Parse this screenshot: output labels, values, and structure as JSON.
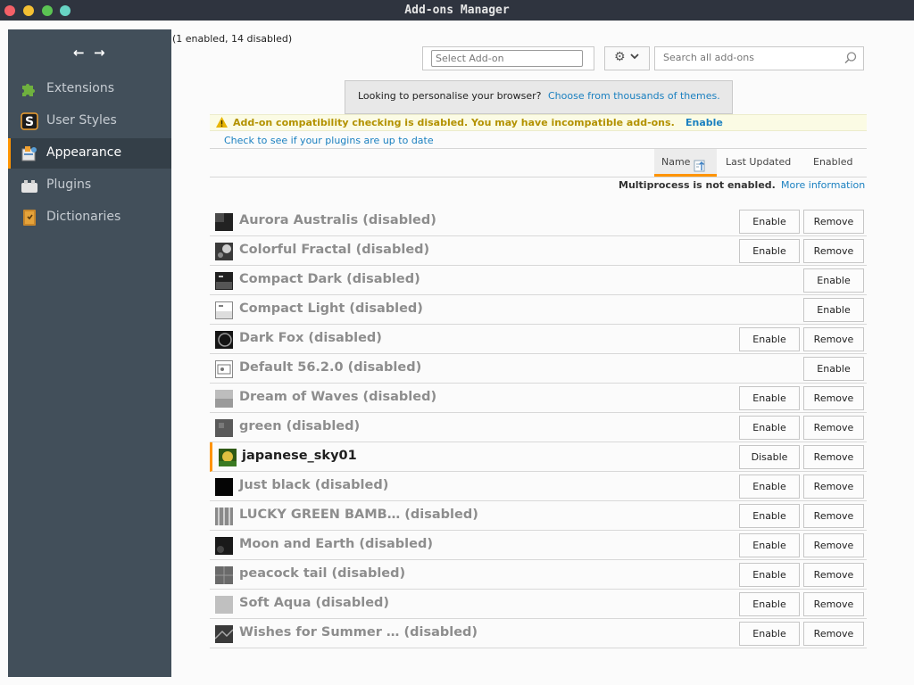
{
  "window": {
    "title": "Add-ons Manager"
  },
  "nav": {
    "back_icon": "arrow-left-icon",
    "forward_icon": "arrow-right-icon"
  },
  "sidebar": {
    "items": [
      {
        "label": "Extensions",
        "icon": "puzzle-icon"
      },
      {
        "label": "User Styles",
        "icon": "stylish-icon"
      },
      {
        "label": "Appearance",
        "icon": "appearance-icon",
        "selected": true
      },
      {
        "label": "Plugins",
        "icon": "plugin-icon"
      },
      {
        "label": "Dictionaries",
        "icon": "dictionary-icon"
      }
    ]
  },
  "header": {
    "summary": "(1 enabled, 14 disabled)",
    "select_placeholder": "Select Add-on",
    "search_placeholder": "Search all add-ons"
  },
  "banner": {
    "text": "Looking to personalise your browser?",
    "link": "Choose from thousands of themes."
  },
  "warning": {
    "text": "Add-on compatibility checking is disabled. You may have incompatible add-ons.",
    "link": "Enable"
  },
  "plugin_check": "Check to see if your plugins are up to date",
  "sort": {
    "name": "Name",
    "last_updated": "Last Updated",
    "enabled": "Enabled"
  },
  "multiprocess": {
    "text": "Multiprocess is not enabled.",
    "link": "More information"
  },
  "buttons": {
    "enable": "Enable",
    "disable": "Disable",
    "remove": "Remove"
  },
  "themes": [
    {
      "name": "Aurora Australis  (disabled)",
      "state": "disabled",
      "removable": true
    },
    {
      "name": "Colorful Fractal  (disabled)",
      "state": "disabled",
      "removable": true
    },
    {
      "name": "Compact Dark  (disabled)",
      "state": "disabled",
      "removable": false
    },
    {
      "name": "Compact Light  (disabled)",
      "state": "disabled",
      "removable": false
    },
    {
      "name": "Dark Fox  (disabled)",
      "state": "disabled",
      "removable": true
    },
    {
      "name": "Default  56.2.0 (disabled)",
      "state": "disabled",
      "removable": false
    },
    {
      "name": "Dream of Waves  (disabled)",
      "state": "disabled",
      "removable": true
    },
    {
      "name": "green  (disabled)",
      "state": "disabled",
      "removable": true
    },
    {
      "name": "japanese_sky01",
      "state": "enabled",
      "removable": true
    },
    {
      "name": "Just black  (disabled)",
      "state": "disabled",
      "removable": true
    },
    {
      "name": "LUCKY GREEN BAMB…  (disabled)",
      "state": "disabled",
      "removable": true
    },
    {
      "name": "Moon and Earth  (disabled)",
      "state": "disabled",
      "removable": true
    },
    {
      "name": "peacock tail  (disabled)",
      "state": "disabled",
      "removable": true
    },
    {
      "name": "Soft Aqua  (disabled)",
      "state": "disabled",
      "removable": true
    },
    {
      "name": "Wishes for Summer …  (disabled)",
      "state": "disabled",
      "removable": true
    }
  ],
  "colors": {
    "accent": "#ff9400",
    "link": "#1b80c0",
    "sidebar": "#424f5a",
    "warning_text": "#b39200"
  }
}
